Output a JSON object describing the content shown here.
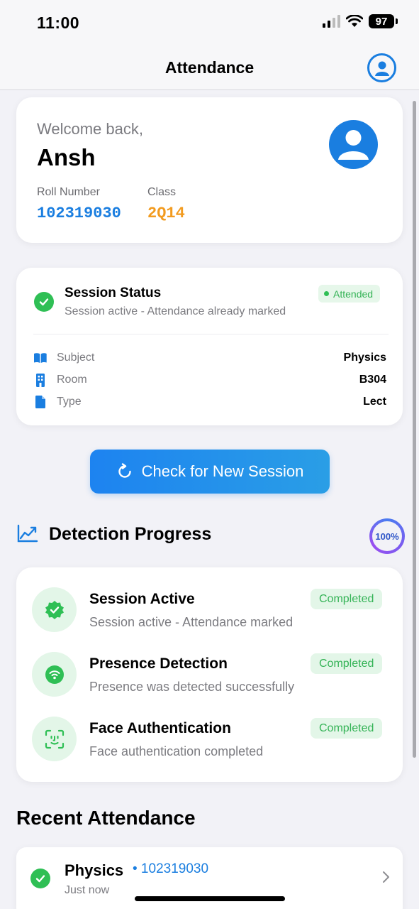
{
  "status_bar": {
    "time": "11:00",
    "battery": "97"
  },
  "nav": {
    "title": "Attendance",
    "profile_icon": "person-circle-icon"
  },
  "welcome": {
    "greeting": "Welcome back,",
    "name": "Ansh",
    "roll_label": "Roll Number",
    "roll_value": "102319030",
    "class_label": "Class",
    "class_value": "2Q14"
  },
  "session": {
    "title": "Session Status",
    "subtitle": "Session active - Attendance already marked",
    "badge": "Attended",
    "details": [
      {
        "icon": "book-icon",
        "label": "Subject",
        "value": "Physics"
      },
      {
        "icon": "building-icon",
        "label": "Room",
        "value": "B304"
      },
      {
        "icon": "document-icon",
        "label": "Type",
        "value": "Lect"
      }
    ]
  },
  "actions": {
    "check_session": "Check for New Session"
  },
  "detection": {
    "title": "Detection Progress",
    "progress": "100%",
    "steps": [
      {
        "icon": "verified-badge-icon",
        "title": "Session Active",
        "subtitle": "Session active - Attendance marked",
        "status": "Completed"
      },
      {
        "icon": "wifi-icon",
        "title": "Presence Detection",
        "subtitle": "Presence was detected successfully",
        "status": "Completed"
      },
      {
        "icon": "face-id-icon",
        "title": "Face Authentication",
        "subtitle": "Face authentication completed",
        "status": "Completed"
      }
    ]
  },
  "recent": {
    "title": "Recent Attendance",
    "items": [
      {
        "subject": "Physics",
        "roll": "• 102319030",
        "time": "Just now"
      }
    ]
  },
  "colors": {
    "accent": "#1a7ee0",
    "success": "#2fbf55",
    "class_orange": "#f29b1f",
    "background": "#f2f2f7"
  }
}
